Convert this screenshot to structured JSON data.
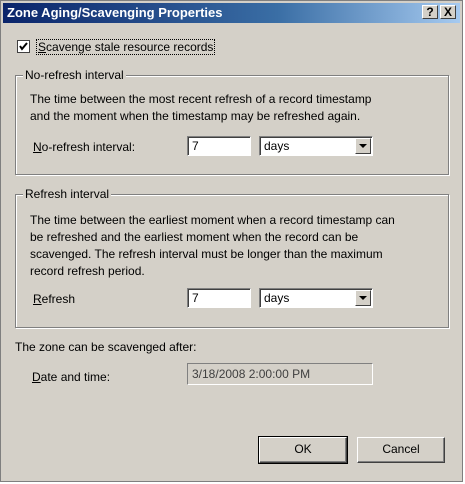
{
  "window": {
    "title": "Zone Aging/Scavenging Properties",
    "help_label": "?",
    "close_label": "X"
  },
  "scavenge": {
    "checked": true,
    "label_first": "S",
    "label_rest": "cavenge stale resource records"
  },
  "no_refresh": {
    "legend": "No-refresh interval",
    "description_line1": "The time between the most recent refresh of a record timestamp",
    "description_line2": "and the moment when the timestamp may be refreshed again.",
    "field_label_first": "N",
    "field_label_rest": "o-refresh interval:",
    "value": "7",
    "unit": "days"
  },
  "refresh": {
    "legend": "Refresh interval",
    "description_line1": "The time between the earliest moment when a record timestamp can",
    "description_line2": "be refreshed and the earliest moment when the record can be",
    "description_line3": "scavenged. The refresh interval must be longer than the maximum",
    "description_line4": "record refresh period.",
    "field_label_first": "R",
    "field_label_rest": "efresh",
    "value": "7",
    "unit": "days"
  },
  "scavenge_after": {
    "heading": "The zone can be scavenged after:",
    "label_first": "D",
    "label_rest": "ate and time:",
    "value": "3/18/2008 2:00:00 PM"
  },
  "buttons": {
    "ok_label": "OK",
    "cancel_label": "Cancel"
  }
}
